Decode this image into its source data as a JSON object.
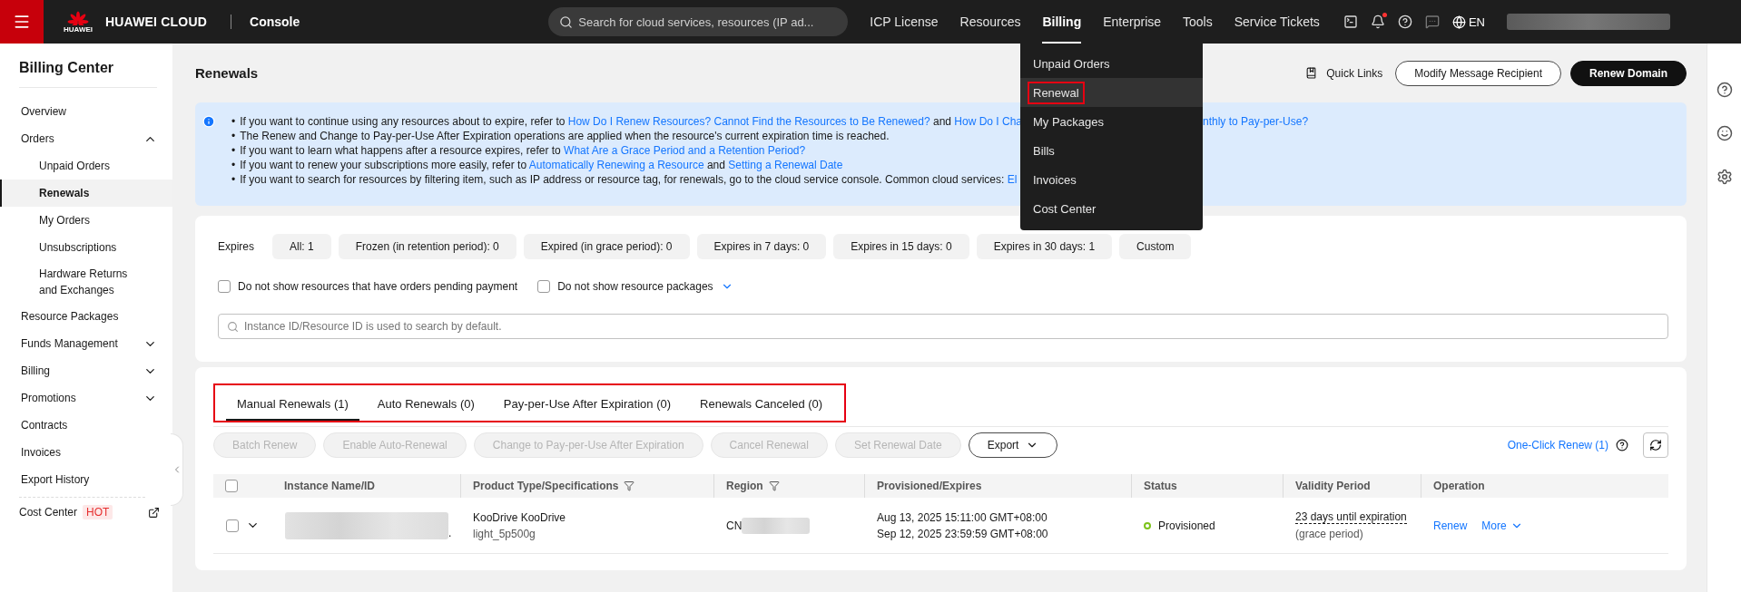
{
  "topbar": {
    "logo_text": "HUAWEI",
    "brand": "HUAWEI CLOUD",
    "section": "Console",
    "search": {
      "placeholder": "Search for cloud services, resources (IP ad..."
    },
    "nav": [
      {
        "label": "ICP License",
        "selected": false
      },
      {
        "label": "Resources",
        "selected": false
      },
      {
        "label": "Billing",
        "selected": true
      },
      {
        "label": "Enterprise",
        "selected": false
      },
      {
        "label": "Tools",
        "selected": false
      },
      {
        "label": "Service Tickets",
        "selected": false
      }
    ],
    "notification": true,
    "language": "EN"
  },
  "billing_menu": [
    {
      "label": "Unpaid Orders",
      "selected": false,
      "annotated": false
    },
    {
      "label": "Renewal",
      "selected": true,
      "annotated": true
    },
    {
      "label": "My Packages",
      "selected": false,
      "annotated": false
    },
    {
      "label": "Bills",
      "selected": false,
      "annotated": false
    },
    {
      "label": "Invoices",
      "selected": false,
      "annotated": false
    },
    {
      "label": "Cost Center",
      "selected": false,
      "annotated": false
    }
  ],
  "sidebar": {
    "title": "Billing Center",
    "items": [
      {
        "label": "Overview",
        "selected": false
      },
      {
        "label": "Orders",
        "selected": false,
        "expanded": true,
        "children": [
          {
            "label": "Unpaid Orders",
            "selected": false
          },
          {
            "label": "Renewals",
            "selected": true
          },
          {
            "label": "My Orders",
            "selected": false
          },
          {
            "label": "Unsubscriptions",
            "selected": false
          },
          {
            "label": "Hardware Returns and Exchanges",
            "selected": false
          }
        ]
      },
      {
        "label": "Resource Packages",
        "selected": false
      },
      {
        "label": "Funds Management",
        "selected": false,
        "expanded": false
      },
      {
        "label": "Billing",
        "selected": false,
        "expanded": false
      },
      {
        "label": "Promotions",
        "selected": false,
        "expanded": false
      },
      {
        "label": "Contracts",
        "selected": false
      },
      {
        "label": "Invoices",
        "selected": false
      },
      {
        "label": "Export History",
        "selected": false
      }
    ],
    "footer": {
      "label": "Cost Center",
      "badge": "HOT"
    }
  },
  "page": {
    "title": "Renewals",
    "quick_links": "Quick Links",
    "buttons": [
      {
        "label": "Modify Message Recipient",
        "primary": false
      },
      {
        "label": "Renew Domain",
        "primary": true
      }
    ]
  },
  "notice": {
    "bullet": "•",
    "lines": [
      {
        "segments": [
          {
            "text": "If you want to continue using any resources about to expire, refer to ",
            "link": false
          },
          {
            "text": "How Do I Renew Resources? Cannot Find the Resources to Be Renewed?",
            "link": true
          },
          {
            "text": " and ",
            "link": false
          },
          {
            "text": "How Do I Cha",
            "link": true
          }
        ],
        "tail": "nthly to Pay-per-Use?"
      },
      {
        "segments": [
          {
            "text": "The Renew and Change to Pay-per-Use After Expiration operations are applied when the resource's current expiration time is reached.",
            "link": false
          }
        ]
      },
      {
        "segments": [
          {
            "text": "If you want to learn what happens after a resource expires, refer to ",
            "link": false
          },
          {
            "text": "What Are a Grace Period and a Retention Period?",
            "link": true
          }
        ]
      },
      {
        "segments": [
          {
            "text": "If you want to renew your subscriptions more easily, refer to ",
            "link": false
          },
          {
            "text": "Automatically Renewing a Resource",
            "link": true
          },
          {
            "text": " and ",
            "link": false
          },
          {
            "text": "Setting a Renewal Date",
            "link": true
          }
        ]
      },
      {
        "segments": [
          {
            "text": "If you want to search for resources by filtering item, such as IP address or resource tag, for renewals, go to the cloud service console. Common cloud services: ",
            "link": false
          },
          {
            "text": "El",
            "link": true
          }
        ]
      }
    ]
  },
  "filters": {
    "label": "Expires",
    "chips": [
      "All: 1",
      "Frozen (in retention period): 0",
      "Expired (in grace period): 0",
      "Expires in 7 days: 0",
      "Expires in 15 days: 0",
      "Expires in 30 days: 1",
      "Custom"
    ],
    "checkboxes": [
      {
        "label": "Do not show resources that have orders pending payment",
        "checked": false,
        "expandable": false
      },
      {
        "label": "Do not show resource packages",
        "checked": false,
        "expandable": true
      }
    ],
    "search": {
      "placeholder": "Instance ID/Resource ID is used to search by default."
    }
  },
  "renewals": {
    "annotated": true,
    "all_checked": false,
    "tabs": [
      {
        "label": "Manual Renewals (1)",
        "selected": true
      },
      {
        "label": "Auto Renewals (0)",
        "selected": false
      },
      {
        "label": "Pay-per-Use After Expiration (0)",
        "selected": false
      },
      {
        "label": "Renewals Canceled (0)",
        "selected": false
      }
    ],
    "actions": [
      {
        "label": "Batch Renew",
        "disabled": true
      },
      {
        "label": "Enable Auto-Renewal",
        "disabled": true
      },
      {
        "label": "Change to Pay-per-Use After Expiration",
        "disabled": true
      },
      {
        "label": "Cancel Renewal",
        "disabled": true
      },
      {
        "label": "Set Renewal Date",
        "disabled": true
      }
    ],
    "export": "Export",
    "one_click": "One-Click Renew (1)",
    "columns": [
      {
        "label": "Instance Name/ID",
        "filter": false
      },
      {
        "label": "Product Type/Specifications",
        "filter": true
      },
      {
        "label": "Region",
        "filter": true
      },
      {
        "label": "Provisioned/Expires",
        "filter": false
      },
      {
        "label": "Status",
        "filter": false
      },
      {
        "label": "Validity Period",
        "filter": false
      },
      {
        "label": "Operation",
        "filter": false
      }
    ],
    "rows": [
      {
        "checked": false,
        "expanded": false,
        "instance_tail": ".",
        "product": "KooDrive KooDrive",
        "spec": "light_5p500g",
        "region": "CN",
        "provisioned": "Aug 13, 2025 15:11:00 GMT+08:00",
        "expires": "Sep 12, 2025 23:59:59 GMT+08:00",
        "status": "Provisioned",
        "color": "#7cc21a",
        "validity": "23 days until expiration",
        "validity_note": "(grace period)",
        "operations": [
          "Renew",
          "More"
        ]
      }
    ]
  }
}
